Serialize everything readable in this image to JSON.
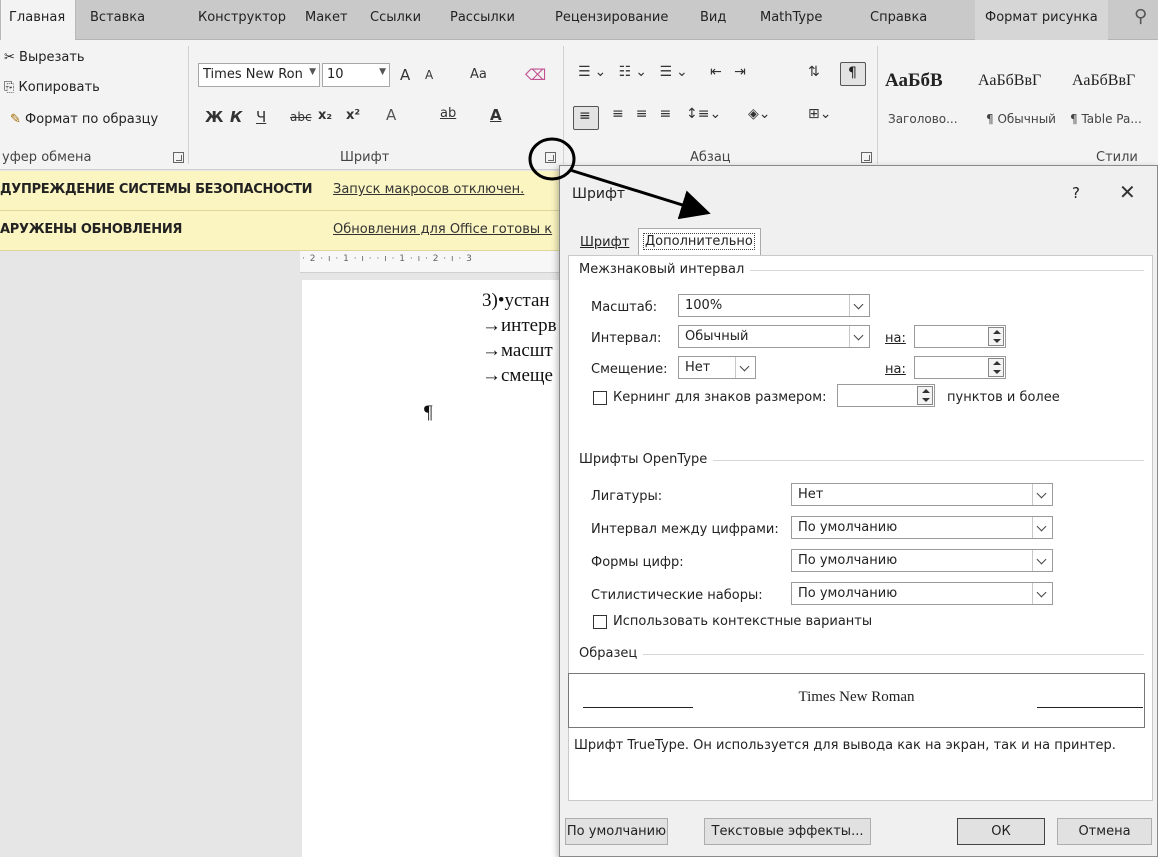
{
  "ribbon": {
    "tabs": [
      "Главная",
      "Вставка",
      "Конструктор",
      "Макет",
      "Ссылки",
      "Рассылки",
      "Рецензирование",
      "Вид",
      "MathType",
      "Справка",
      "Формат рисунка"
    ],
    "clipboard": {
      "cut": "Вырезать",
      "copy": "Копировать",
      "format_painter": "Формат по образцу",
      "group": "уфер обмена"
    },
    "font": {
      "name": "Times New Ron",
      "size": "10",
      "group": "Шрифт",
      "grow": "A",
      "shrink": "A",
      "case": "Aa",
      "bold": "Ж",
      "italic": "К",
      "underline": "Ч",
      "strike": "abc",
      "sub": "x₂",
      "sup": "x²",
      "effects": "A",
      "highlight": "ab",
      "color": "A"
    },
    "paragraph": {
      "group": "Абзац"
    },
    "styles": {
      "group": "Стили",
      "sample1": "АаБбВ",
      "sample2": "АаБбВвГ",
      "sample3": "АаБбВвГ",
      "name1": "Заголово...",
      "name2": "¶ Обычный",
      "name3": "¶ Table Pa..."
    }
  },
  "infobars": {
    "security_bold": "ДУПРЕЖДЕНИЕ СИСТЕМЫ БЕЗОПАСНОСТИ",
    "security_link": "Запуск макросов отключен.",
    "updates_bold": "АРУЖЕНЫ ОБНОВЛЕНИЯ",
    "updates_link": "Обновления для Office готовы к"
  },
  "ruler": "· 2 · ı · 1 · ı ·   · ı · 1 · ı · 2 · ı · 3",
  "document": {
    "lines": [
      "3)•устан",
      "→интерв",
      "→масшт",
      "→смеще"
    ],
    "pilcrow": "¶"
  },
  "dialog": {
    "title": "Шрифт",
    "help": "?",
    "close": "✕",
    "tab_font": "Шрифт",
    "tab_advanced": "Дополнительно",
    "spacing_section": "Межзнаковый интервал",
    "scale_label": "Масштаб:",
    "scale_value": "100%",
    "interval_label": "Интервал:",
    "interval_value": "Обычный",
    "interval_by": "на:",
    "offset_label": "Смещение:",
    "offset_value": "Нет",
    "offset_by": "на:",
    "kerning_label": "Кернинг для знаков размером:",
    "kerning_suffix": "пунктов и более",
    "opentype_section": "Шрифты OpenType",
    "ligatures_label": "Лигатуры:",
    "ligatures_value": "Нет",
    "numspacing_label": "Интервал между цифрами:",
    "numspacing_value": "По умолчанию",
    "numforms_label": "Формы цифр:",
    "numforms_value": "По умолчанию",
    "stylistic_label": "Стилистические наборы:",
    "stylistic_value": "По умолчанию",
    "contextual_label": "Использовать контекстные варианты",
    "sample_section": "Образец",
    "sample_text": "Times New Roman",
    "truetype_note": "Шрифт TrueType. Он используется для вывода как на экран, так и на принтер.",
    "btn_default": "По умолчанию",
    "btn_effects": "Текстовые эффекты...",
    "btn_ok": "ОК",
    "btn_cancel": "Отмена"
  }
}
